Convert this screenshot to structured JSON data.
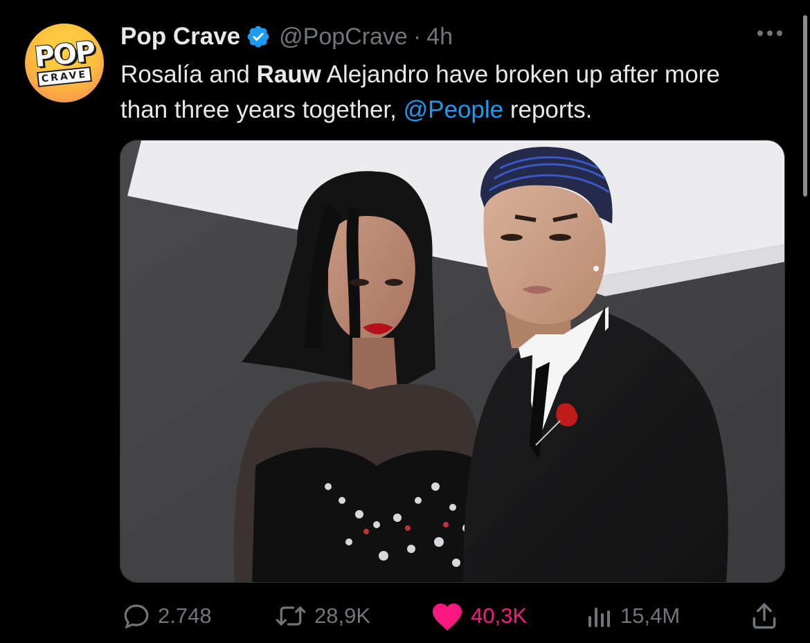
{
  "tweet": {
    "author_name": "Pop Crave",
    "handle": "@PopCrave",
    "separator": "·",
    "time": "4h",
    "text_part1": "Rosalía and ",
    "text_bold": "Rauw",
    "text_part2": " Alejandro have broken up after more than three years together, ",
    "mention": "@People",
    "text_part3": " reports."
  },
  "avatar": {
    "logo_top": "POP",
    "logo_bottom": "CRAVE"
  },
  "actions": {
    "replies": "2.748",
    "reposts": "28,9K",
    "likes": "40,3K",
    "views": "15,4M"
  },
  "colors": {
    "background": "#000000",
    "text": "#e7e9ea",
    "muted": "#71767b",
    "link": "#1d9bf0",
    "like": "#f91880",
    "verified": "#1d9bf0"
  },
  "icons": {
    "verified": "verified-badge-icon",
    "more": "more-horizontal-icon",
    "reply": "reply-bubble-icon",
    "repost": "repost-arrows-icon",
    "like": "heart-filled-icon",
    "views": "bar-chart-icon",
    "share": "share-upload-icon"
  }
}
